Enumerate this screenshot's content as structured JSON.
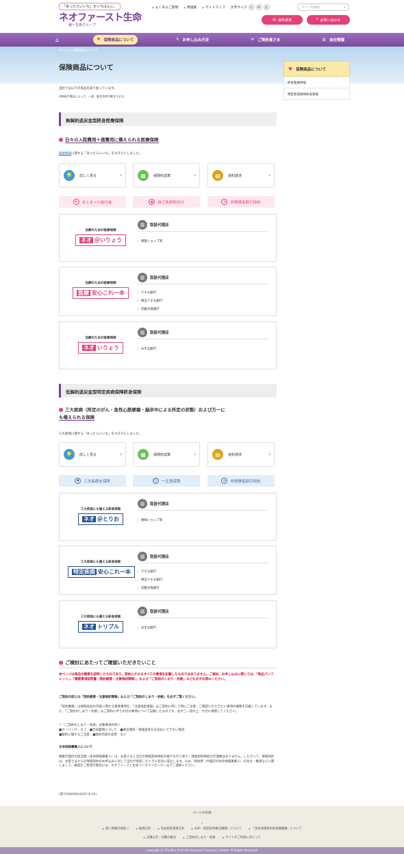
{
  "header": {
    "tagline": "「あったらいいな」をいちばんに。",
    "logo": "ネオファースト生命",
    "logo_sub": "第一生命グループ",
    "util_links": [
      "よくあるご質問",
      "用語集",
      "サイトマップ"
    ],
    "font_size_label": "文字サイズ",
    "font_sizes": [
      "小",
      "中",
      "大"
    ],
    "search_placeholder": "サイト内検索",
    "btn_request": "資料請求",
    "btn_contact": "お問い合わせ"
  },
  "mainnav": [
    {
      "label": "保険商品について",
      "active": true
    },
    {
      "label": "お申し込み方法",
      "active": false
    },
    {
      "label": "ご契約者さま",
      "active": false
    },
    {
      "label": "会社情報",
      "active": false
    }
  ],
  "breadcrumb": "ホーム ＞ 保険商品について",
  "page_title": "保険商品について",
  "sidebar": {
    "heading": "保険商品について",
    "items": [
      "終身医療保険",
      "特定疾病保障終身保険"
    ]
  },
  "intro": [
    "当社では以下の商品を取り扱っています。",
    "※取扱代理店によって、一部、販売名称が異なります。"
  ],
  "section1": {
    "title": "無解約返戻金型終身医療保険",
    "subtitle": "日々の入院費用＋諸費用に備えられる医療保険",
    "desc_link": "医療保険",
    "desc_rest": "に関する「あったらいいな」をカタチにしました。",
    "actions": [
      "詳しく見る",
      "保険料試算",
      "資料請求"
    ],
    "features": [
      "まとまった給付金",
      "自己負担相当分",
      "非喫煙者割引特約"
    ],
    "cards": [
      {
        "caption": "治療のための医療保険",
        "mark": "ネオ",
        "name": "＠いりょう",
        "agent_title": "取扱代理店",
        "agents": [
          "保険ショップ等"
        ]
      },
      {
        "caption": "治療のための医療保険",
        "mark": "医療",
        "name": "安心これ一本",
        "agent_title": "取扱代理店",
        "agents": [
          "りそな銀行",
          "埼玉りそな銀行",
          "近畿大阪銀行"
        ]
      },
      {
        "caption": "治療のための医療保険",
        "mark": "ネオ",
        "name": "いりょう",
        "agent_title": "取扱代理店",
        "agents": [
          "みずほ銀行"
        ]
      }
    ]
  },
  "section2": {
    "title": "低解約返戻金型特定疾病保障終身保険",
    "subtitle_l1": "三大疾病（所定のがん・急性心筋梗塞・脳卒中による所定の状態）および万一に",
    "subtitle_l2": "も備えられる保険",
    "desc": "三大疾病に関する「あったらいいな」をカタチにしました。",
    "actions": [
      "詳しく見る",
      "保険料試算",
      "資料請求"
    ],
    "features": [
      "三大疾病を保障",
      "一生涯保障",
      "非喫煙者割引特約"
    ],
    "cards": [
      {
        "caption": "三大疾病にも備える終身保険",
        "mark": "ネオ",
        "name": "＠とりお",
        "agent_title": "取扱代理店",
        "agents": [
          "保険ショップ等"
        ]
      },
      {
        "caption": "三大疾病にも備える終身保険",
        "mark": "特定疾病",
        "name": "安心これ一本",
        "agent_title": "取扱代理店",
        "agents": [
          "りそな銀行",
          "埼玉りそな銀行",
          "近畿大阪銀行"
        ]
      },
      {
        "caption": "三大疾病にも備える終身保険",
        "mark": "ネオ",
        "name": "トリプル",
        "agent_title": "取扱代理店",
        "agents": [
          "みずほ銀行"
        ]
      }
    ]
  },
  "notice": {
    "title": "ご検討にあたってご確認いただきたいこと",
    "red": "本ページは商品の概要を説明したものであり、契約にかかるすべての事項を記載したものではありません。ご検討、お申し込みに際しては、「商品パンフレット」、「重要事項説明書（契約概要・注意喚起情報）」および「ご契約のしおり・約款」などを必ずお読みください。",
    "bold1": "ご契約の前には「契約概要・注意喚起情報」および「ご契約のしおり・約款」を必ずご覧ください。",
    "p1": "「契約概要」は保険商品の内容に関する重要事項を、「注意喚起情報」はご契約に際して特にご注意、ご確認いただきたい事項の概略を記載しています。また、「ご契約のしおり・約款」はご契約に伴う大切な事項について記載したものです。必ずご一読の上、大切に保管してください。",
    "list_title": "＜「ご契約のしおり・約款」記載事項の例＞",
    "list1": "■クーリング・オフ　■告知義務について　■責任開始・保険金等をお支払いできない場合",
    "list2": "■解約に関するご注意　■契約内容の変更　など",
    "bold2": "生命保険募集人について",
    "p2": "募集代理店の担当者（生命保険募集人）は、お客さまと当社の保険契約締結の媒介を行う者で、保険契約締結の代理権はありません。したがって、保険契約は、お客さまからの保険契約のお申込みに対して当社が承諾したときに有効に成立します。なお、取扱者（代理店の生命保険募集人）の身分・権限などに関しまして、確認をご希望の場合には、ネオファースト生命コンタクトセンターまでご連絡ください。",
    "code": "(登)15N4004(2015.8.10)"
  },
  "footer": {
    "pagetop": "ページの先頭",
    "row1": [
      "個人情報の取扱い",
      "勧誘方針",
      "利益相反管理方針",
      "ADR（指定紛争解決機関）について",
      "「生命保険契約者保護機構」について"
    ],
    "row2": [
      "決算公告・決算の概況",
      "ご契約のしおり・約款",
      "サイトのご利用にあたって"
    ],
    "copyright": "Copyright (c) The Neo First Life Insurance Company, Limited. All Rights Reserved."
  },
  "colors": {
    "brand": "#7a3b9c",
    "accent": "#e2417a",
    "nav_active": "#fbe9a8"
  }
}
